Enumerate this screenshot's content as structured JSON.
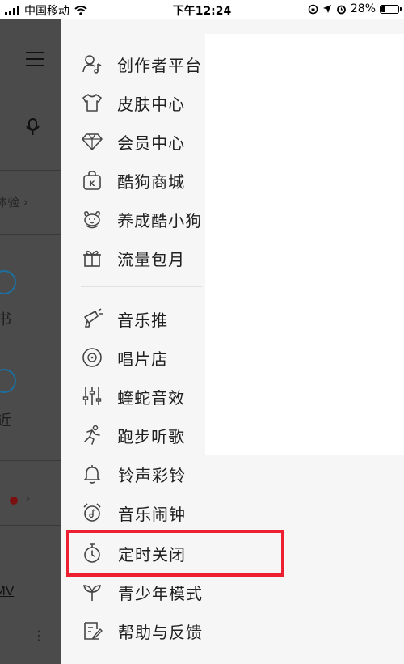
{
  "status_bar": {
    "carrier": "中国移动",
    "time": "下午12:24",
    "battery": "28%",
    "battery_level": 0.28
  },
  "background_page": {
    "experience_text": "体验",
    "book_text": "书",
    "recent_text": "近",
    "mv_text": "MV"
  },
  "menu": {
    "group1": [
      {
        "label": "创作者平台",
        "icon": "person-music-icon"
      },
      {
        "label": "皮肤中心",
        "icon": "tshirt-icon"
      },
      {
        "label": "会员中心",
        "icon": "diamond-icon"
      },
      {
        "label": "酷狗商城",
        "icon": "shopping-bag-icon"
      },
      {
        "label": "养成酷小狗",
        "icon": "puppy-icon"
      },
      {
        "label": "流量包月",
        "icon": "gift-icon"
      }
    ],
    "group2": [
      {
        "label": "音乐推",
        "icon": "megaphone-icon"
      },
      {
        "label": "唱片店",
        "icon": "vinyl-record-icon"
      },
      {
        "label": "蝰蛇音效",
        "icon": "equalizer-icon"
      },
      {
        "label": "跑步听歌",
        "icon": "running-icon"
      },
      {
        "label": "铃声彩铃",
        "icon": "bell-icon"
      },
      {
        "label": "音乐闹钟",
        "icon": "alarm-clock-icon"
      },
      {
        "label": "定时关闭",
        "icon": "timer-icon"
      },
      {
        "label": "青少年模式",
        "icon": "sprout-icon"
      },
      {
        "label": "帮助与反馈",
        "icon": "feedback-icon"
      }
    ]
  },
  "colors": {
    "highlight": "#ec2030",
    "overlay": "#4b4b4b",
    "drawer_bg": "#f6f6f6"
  }
}
